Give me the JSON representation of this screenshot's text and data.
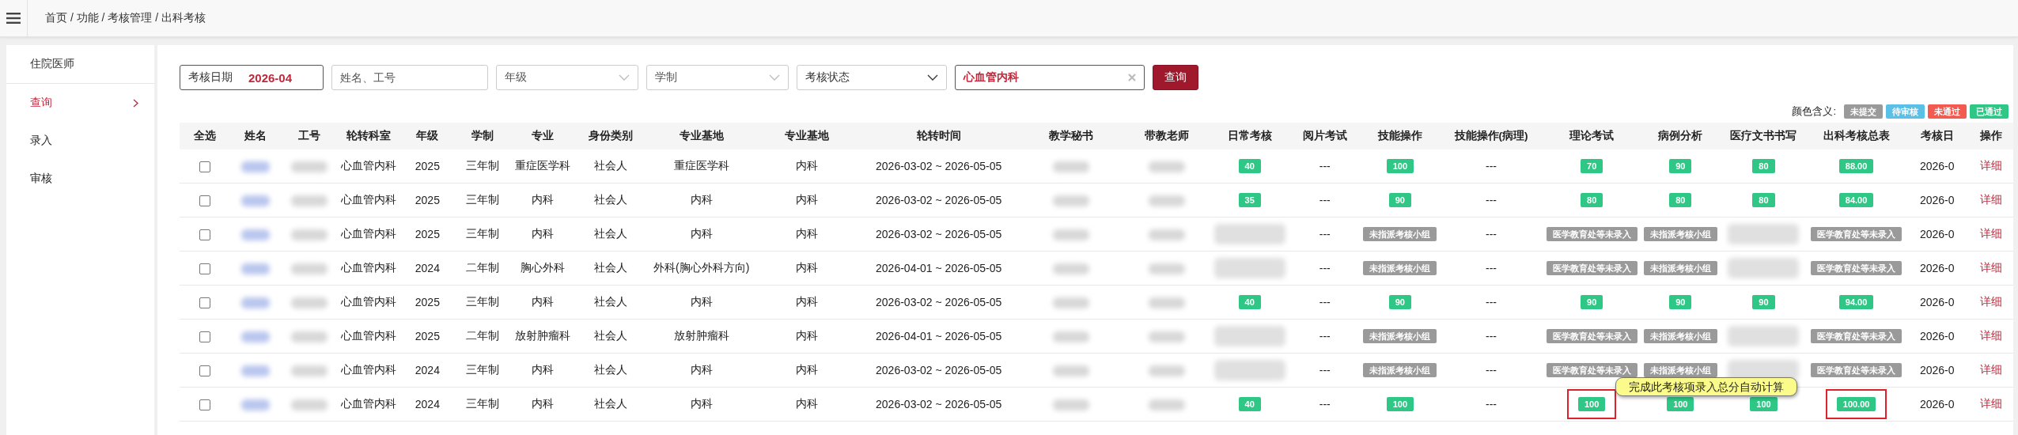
{
  "topbar": {
    "breadcrumb": "首页 / 功能 / 考核管理 / 出科考核"
  },
  "sidebar": {
    "title": "住院医师",
    "items": [
      {
        "label": "查询",
        "selected": true
      },
      {
        "label": "录入",
        "selected": false
      },
      {
        "label": "审核",
        "selected": false
      }
    ]
  },
  "filters": {
    "date": {
      "label": "考核日期",
      "value": "2026-04"
    },
    "name": {
      "placeholder": "姓名、工号"
    },
    "grade": {
      "placeholder": "年级"
    },
    "system": {
      "placeholder": "学制"
    },
    "status": {
      "placeholder": "考核状态"
    },
    "dept": {
      "value": "心血管内科"
    },
    "search_button": "查询"
  },
  "legend": {
    "label": "颜色含义:",
    "items": [
      {
        "label": "未提交",
        "color": "#9a9a9a"
      },
      {
        "label": "待审核",
        "color": "#5bc0e8"
      },
      {
        "label": "未通过",
        "color": "#f35a50"
      },
      {
        "label": "已通过",
        "color": "#2ec785"
      }
    ]
  },
  "table": {
    "columns": [
      "全选",
      "姓名",
      "工号",
      "轮转科室",
      "年级",
      "学制",
      "专业",
      "身份类别",
      "专业基地",
      "专业基地",
      "轮转时间",
      "教学秘书",
      "带教老师",
      "日常考核",
      "阅片考试",
      "技能操作",
      "技能操作(病理)",
      "理论考试",
      "病例分析",
      "医疗文书书写",
      "出科考核总表",
      "考核日",
      "操作"
    ],
    "rows": [
      {
        "cells": [
          {
            "kind": "check",
            "checked": false
          },
          {
            "kind": "blur-link"
          },
          {
            "kind": "blur"
          },
          {
            "kind": "text",
            "text": "心血管内科"
          },
          {
            "kind": "text",
            "text": "2025"
          },
          {
            "kind": "text",
            "text": "三年制"
          },
          {
            "kind": "text",
            "text": "重症医学科"
          },
          {
            "kind": "text",
            "text": "社会人"
          },
          {
            "kind": "text",
            "text": "重症医学科"
          },
          {
            "kind": "text",
            "text": "内科"
          },
          {
            "kind": "text",
            "text": "2026-03-02 ~ 2026-05-05"
          },
          {
            "kind": "blur"
          },
          {
            "kind": "blur"
          },
          {
            "kind": "badge",
            "text": "40",
            "color": "#2ec785"
          },
          {
            "kind": "text",
            "text": "---"
          },
          {
            "kind": "badge",
            "text": "100",
            "color": "#2ec785"
          },
          {
            "kind": "text",
            "text": "---"
          },
          {
            "kind": "badge",
            "text": "70",
            "color": "#2ec785"
          },
          {
            "kind": "badge",
            "text": "90",
            "color": "#2ec785"
          },
          {
            "kind": "badge",
            "text": "80",
            "color": "#2ec785"
          },
          {
            "kind": "badge",
            "text": "88.00",
            "color": "#2ec785"
          },
          {
            "kind": "text",
            "text": "2026-0"
          },
          {
            "kind": "link",
            "text": "详细"
          }
        ]
      },
      {
        "cells": [
          {
            "kind": "check",
            "checked": false
          },
          {
            "kind": "blur-link"
          },
          {
            "kind": "blur"
          },
          {
            "kind": "text",
            "text": "心血管内科"
          },
          {
            "kind": "text",
            "text": "2025"
          },
          {
            "kind": "text",
            "text": "三年制"
          },
          {
            "kind": "text",
            "text": "内科"
          },
          {
            "kind": "text",
            "text": "社会人"
          },
          {
            "kind": "text",
            "text": "内科"
          },
          {
            "kind": "text",
            "text": "内科"
          },
          {
            "kind": "text",
            "text": "2026-03-02 ~ 2026-05-05"
          },
          {
            "kind": "blur"
          },
          {
            "kind": "blur"
          },
          {
            "kind": "badge",
            "text": "35",
            "color": "#2ec785"
          },
          {
            "kind": "text",
            "text": "---"
          },
          {
            "kind": "badge",
            "text": "90",
            "color": "#2ec785"
          },
          {
            "kind": "text",
            "text": "---"
          },
          {
            "kind": "badge",
            "text": "80",
            "color": "#2ec785"
          },
          {
            "kind": "badge",
            "text": "80",
            "color": "#2ec785"
          },
          {
            "kind": "badge",
            "text": "80",
            "color": "#2ec785"
          },
          {
            "kind": "badge",
            "text": "84.00",
            "color": "#2ec785"
          },
          {
            "kind": "text",
            "text": "2026-0"
          },
          {
            "kind": "link",
            "text": "详细"
          }
        ]
      },
      {
        "cells": [
          {
            "kind": "check",
            "checked": false
          },
          {
            "kind": "blur-link"
          },
          {
            "kind": "blur"
          },
          {
            "kind": "text",
            "text": "心血管内科"
          },
          {
            "kind": "text",
            "text": "2025"
          },
          {
            "kind": "text",
            "text": "三年制"
          },
          {
            "kind": "text",
            "text": "内科"
          },
          {
            "kind": "text",
            "text": "社会人"
          },
          {
            "kind": "text",
            "text": "内科"
          },
          {
            "kind": "text",
            "text": "内科"
          },
          {
            "kind": "text",
            "text": "2026-03-02 ~ 2026-05-05"
          },
          {
            "kind": "blur"
          },
          {
            "kind": "blur"
          },
          {
            "kind": "blur-block"
          },
          {
            "kind": "text",
            "text": "---"
          },
          {
            "kind": "badge",
            "text": "未指派考核小组",
            "color": "#9a9a9a"
          },
          {
            "kind": "text",
            "text": "---"
          },
          {
            "kind": "badge",
            "text": "医学教育处等未录入",
            "color": "#9a9a9a"
          },
          {
            "kind": "badge",
            "text": "未指派考核小组",
            "color": "#9a9a9a"
          },
          {
            "kind": "blur-block"
          },
          {
            "kind": "badge",
            "text": "医学教育处等未录入",
            "color": "#9a9a9a"
          },
          {
            "kind": "text",
            "text": "2026-0"
          },
          {
            "kind": "link",
            "text": "详细"
          }
        ]
      },
      {
        "cells": [
          {
            "kind": "check",
            "checked": false
          },
          {
            "kind": "blur-link"
          },
          {
            "kind": "blur"
          },
          {
            "kind": "text",
            "text": "心血管内科"
          },
          {
            "kind": "text",
            "text": "2024"
          },
          {
            "kind": "text",
            "text": "二年制"
          },
          {
            "kind": "text",
            "text": "胸心外科"
          },
          {
            "kind": "text",
            "text": "社会人"
          },
          {
            "kind": "text",
            "text": "外科(胸心外科方向)"
          },
          {
            "kind": "text",
            "text": "内科"
          },
          {
            "kind": "text",
            "text": "2026-04-01 ~ 2026-05-05"
          },
          {
            "kind": "blur"
          },
          {
            "kind": "blur"
          },
          {
            "kind": "blur-block"
          },
          {
            "kind": "text",
            "text": "---"
          },
          {
            "kind": "badge",
            "text": "未指派考核小组",
            "color": "#9a9a9a"
          },
          {
            "kind": "text",
            "text": "---"
          },
          {
            "kind": "badge",
            "text": "医学教育处等未录入",
            "color": "#9a9a9a"
          },
          {
            "kind": "badge",
            "text": "未指派考核小组",
            "color": "#9a9a9a"
          },
          {
            "kind": "blur-block"
          },
          {
            "kind": "badge",
            "text": "医学教育处等未录入",
            "color": "#9a9a9a"
          },
          {
            "kind": "text",
            "text": "2026-0"
          },
          {
            "kind": "link",
            "text": "详细"
          }
        ]
      },
      {
        "cells": [
          {
            "kind": "check",
            "checked": false
          },
          {
            "kind": "blur-link"
          },
          {
            "kind": "blur"
          },
          {
            "kind": "text",
            "text": "心血管内科"
          },
          {
            "kind": "text",
            "text": "2025"
          },
          {
            "kind": "text",
            "text": "三年制"
          },
          {
            "kind": "text",
            "text": "内科"
          },
          {
            "kind": "text",
            "text": "社会人"
          },
          {
            "kind": "text",
            "text": "内科"
          },
          {
            "kind": "text",
            "text": "内科"
          },
          {
            "kind": "text",
            "text": "2026-03-02 ~ 2026-05-05"
          },
          {
            "kind": "blur"
          },
          {
            "kind": "blur"
          },
          {
            "kind": "badge",
            "text": "40",
            "color": "#2ec785"
          },
          {
            "kind": "text",
            "text": "---"
          },
          {
            "kind": "badge",
            "text": "90",
            "color": "#2ec785"
          },
          {
            "kind": "text",
            "text": "---"
          },
          {
            "kind": "badge",
            "text": "90",
            "color": "#2ec785"
          },
          {
            "kind": "badge",
            "text": "90",
            "color": "#2ec785"
          },
          {
            "kind": "badge",
            "text": "90",
            "color": "#2ec785"
          },
          {
            "kind": "badge",
            "text": "94.00",
            "color": "#2ec785"
          },
          {
            "kind": "text",
            "text": "2026-0"
          },
          {
            "kind": "link",
            "text": "详细"
          }
        ]
      },
      {
        "cells": [
          {
            "kind": "check",
            "checked": false
          },
          {
            "kind": "blur-link"
          },
          {
            "kind": "blur"
          },
          {
            "kind": "text",
            "text": "心血管内科"
          },
          {
            "kind": "text",
            "text": "2025"
          },
          {
            "kind": "text",
            "text": "二年制"
          },
          {
            "kind": "text",
            "text": "放射肿瘤科"
          },
          {
            "kind": "text",
            "text": "社会人"
          },
          {
            "kind": "text",
            "text": "放射肿瘤科"
          },
          {
            "kind": "text",
            "text": "内科"
          },
          {
            "kind": "text",
            "text": "2026-04-01 ~ 2026-05-05"
          },
          {
            "kind": "blur"
          },
          {
            "kind": "blur"
          },
          {
            "kind": "blur-block"
          },
          {
            "kind": "text",
            "text": "---"
          },
          {
            "kind": "badge",
            "text": "未指派考核小组",
            "color": "#9a9a9a"
          },
          {
            "kind": "text",
            "text": "---"
          },
          {
            "kind": "badge",
            "text": "医学教育处等未录入",
            "color": "#9a9a9a"
          },
          {
            "kind": "badge",
            "text": "未指派考核小组",
            "color": "#9a9a9a"
          },
          {
            "kind": "blur-block"
          },
          {
            "kind": "badge",
            "text": "医学教育处等未录入",
            "color": "#9a9a9a"
          },
          {
            "kind": "text",
            "text": "2026-0"
          },
          {
            "kind": "link",
            "text": "详细"
          }
        ]
      },
      {
        "cells": [
          {
            "kind": "check",
            "checked": false
          },
          {
            "kind": "blur-link"
          },
          {
            "kind": "blur"
          },
          {
            "kind": "text",
            "text": "心血管内科"
          },
          {
            "kind": "text",
            "text": "2024"
          },
          {
            "kind": "text",
            "text": "三年制"
          },
          {
            "kind": "text",
            "text": "内科"
          },
          {
            "kind": "text",
            "text": "社会人"
          },
          {
            "kind": "text",
            "text": "内科"
          },
          {
            "kind": "text",
            "text": "内科"
          },
          {
            "kind": "text",
            "text": "2026-03-02 ~ 2026-05-05"
          },
          {
            "kind": "blur"
          },
          {
            "kind": "blur"
          },
          {
            "kind": "blur-block"
          },
          {
            "kind": "text",
            "text": "---"
          },
          {
            "kind": "badge",
            "text": "未指派考核小组",
            "color": "#9a9a9a"
          },
          {
            "kind": "text",
            "text": "---"
          },
          {
            "kind": "badge",
            "text": "医学教育处等未录入",
            "color": "#9a9a9a"
          },
          {
            "kind": "badge",
            "text": "未指派考核小组",
            "color": "#9a9a9a"
          },
          {
            "kind": "blur-block"
          },
          {
            "kind": "badge",
            "text": "医学教育处等未录入",
            "color": "#9a9a9a"
          },
          {
            "kind": "text",
            "text": "2026-0"
          },
          {
            "kind": "link",
            "text": "详细"
          }
        ]
      },
      {
        "cells": [
          {
            "kind": "check",
            "checked": false
          },
          {
            "kind": "blur-link"
          },
          {
            "kind": "blur"
          },
          {
            "kind": "text",
            "text": "心血管内科"
          },
          {
            "kind": "text",
            "text": "2024"
          },
          {
            "kind": "text",
            "text": "三年制"
          },
          {
            "kind": "text",
            "text": "内科"
          },
          {
            "kind": "text",
            "text": "社会人"
          },
          {
            "kind": "text",
            "text": "内科"
          },
          {
            "kind": "text",
            "text": "内科"
          },
          {
            "kind": "text",
            "text": "2026-03-02 ~ 2026-05-05"
          },
          {
            "kind": "blur"
          },
          {
            "kind": "blur"
          },
          {
            "kind": "badge",
            "text": "40",
            "color": "#2ec785"
          },
          {
            "kind": "text",
            "text": "---"
          },
          {
            "kind": "badge",
            "text": "100",
            "color": "#2ec785"
          },
          {
            "kind": "text",
            "text": "---"
          },
          {
            "kind": "badge",
            "text": "100",
            "color": "#2ec785",
            "highlighted": true
          },
          {
            "kind": "badge",
            "text": "100",
            "color": "#2ec785"
          },
          {
            "kind": "badge",
            "text": "100",
            "color": "#2ec785"
          },
          {
            "kind": "badge",
            "text": "100.00",
            "color": "#2ec785",
            "highlighted": true
          },
          {
            "kind": "text",
            "text": "2026-0"
          },
          {
            "kind": "link",
            "text": "详细"
          }
        ]
      }
    ]
  },
  "tooltip": {
    "text": "完成此考核项录入总分自动计算"
  }
}
